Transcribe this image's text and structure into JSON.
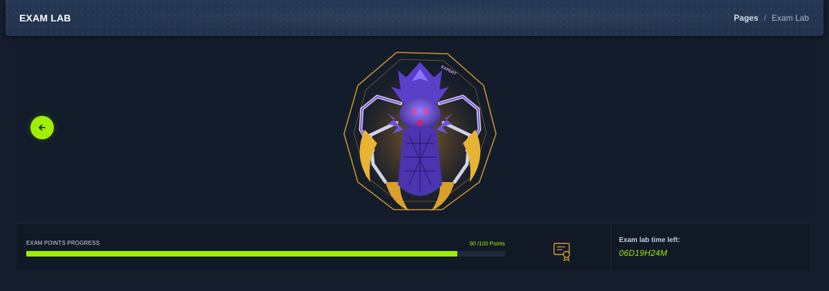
{
  "header": {
    "title": "EXAM LAB",
    "breadcrumb": {
      "link": "Pages",
      "separator": "/",
      "current": "Exam Lab"
    }
  },
  "hero": {
    "back_icon": "arrow-left-icon",
    "badge_label": "EXPERT",
    "badge_icon": "spider-mascot-badge"
  },
  "progress": {
    "label": "EXAM POINTS PROGRESS",
    "current": 90,
    "total": 100,
    "points_text": "90 /100 Points",
    "cert_icon": "certificate-icon"
  },
  "timer": {
    "label": "Exam lab time left:",
    "value": "06D19H24M"
  },
  "colors": {
    "accent": "#9fef00",
    "background": "#141d2b",
    "header": "#263856",
    "badge_gold": "#e0a526",
    "badge_purple": "#6b4fd8"
  }
}
